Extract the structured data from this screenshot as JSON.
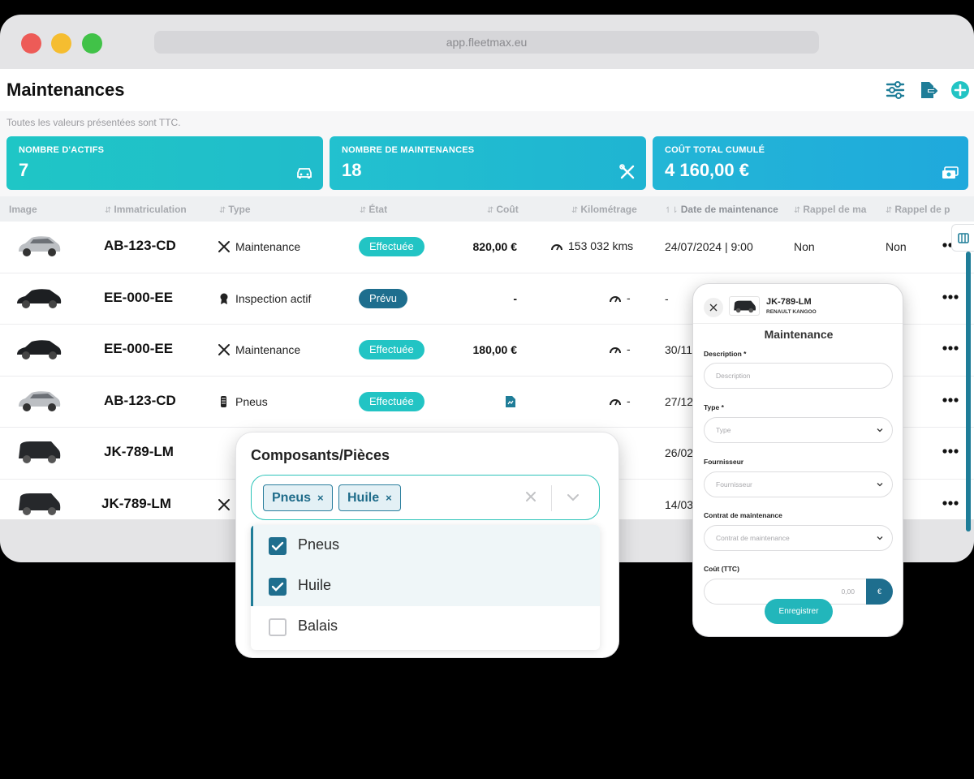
{
  "browser": {
    "url": "app.fleetmax.eu"
  },
  "header": {
    "title": "Maintenances",
    "note": "Toutes les valeurs présentées sont TTC."
  },
  "kpis": [
    {
      "label": "NOMBRE D'ACTIFS",
      "value": "7",
      "icon": "car-icon"
    },
    {
      "label": "NOMBRE DE MAINTENANCES",
      "value": "18",
      "icon": "tools-icon"
    },
    {
      "label": "COÛT TOTAL CUMULÉ",
      "value": "4 160,00 €",
      "icon": "money-icon"
    }
  ],
  "table": {
    "columns": [
      "Image",
      "Immatriculation",
      "Type",
      "État",
      "Coût",
      "Kilométrage",
      "Date de maintenance",
      "Rappel de ma",
      "Rappel de p"
    ],
    "rows": [
      {
        "plate": "AB-123-CD",
        "type": "Maintenance",
        "state": "Effectuée",
        "cost": "820,00 €",
        "km": "153 032 kms",
        "date": "24/07/2024 | 9:00",
        "rappel1": "Non",
        "rappel2": "Non"
      },
      {
        "plate": "EE-000-EE",
        "type": "Inspection actif",
        "state": "Prévu",
        "cost": "-",
        "km": "-",
        "date": "-",
        "rappel1": "",
        "rappel2": ""
      },
      {
        "plate": "EE-000-EE",
        "type": "Maintenance",
        "state": "Effectuée",
        "cost": "180,00 €",
        "km": "-",
        "date": "30/11",
        "rappel1": "",
        "rappel2": ""
      },
      {
        "plate": "AB-123-CD",
        "type": "Pneus",
        "state": "Effectuée",
        "cost": "",
        "km": "-",
        "date": "27/12",
        "rappel1": "",
        "rappel2": ""
      },
      {
        "plate": "JK-789-LM",
        "type": "",
        "state": "",
        "cost": "",
        "km": "",
        "date": "26/02",
        "rappel1": "",
        "rappel2": ""
      },
      {
        "plate": "JK-789-LM",
        "type": "",
        "state": "",
        "cost": "",
        "km": "",
        "date": "14/03",
        "rappel1": "",
        "rappel2": ""
      }
    ]
  },
  "multiselect": {
    "title": "Composants/Pièces",
    "chips": [
      "Pneus",
      "Huile"
    ],
    "chip_remove": "×",
    "options": [
      {
        "label": "Pneus",
        "checked": true
      },
      {
        "label": "Huile",
        "checked": true
      },
      {
        "label": "Balais",
        "checked": false
      }
    ]
  },
  "form": {
    "vehicle_plate": "JK-789-LM",
    "vehicle_model": "RENAULT KANGOO",
    "title": "Maintenance",
    "description_label": "Description *",
    "description_placeholder": "Description",
    "type_label": "Type *",
    "type_placeholder": "Type",
    "supplier_label": "Fournisseur",
    "supplier_placeholder": "Fournisseur",
    "contract_label": "Contrat de maintenance",
    "contract_placeholder": "Contrat de maintenance",
    "cost_label": "Coût (TTC)",
    "cost_placeholder": "0,00",
    "currency": "€",
    "save_label": "Enregistrer"
  },
  "colors": {
    "teal": "#22c4c4",
    "accent": "#1f6e8e",
    "primary_blue": "#1fa9dc"
  }
}
